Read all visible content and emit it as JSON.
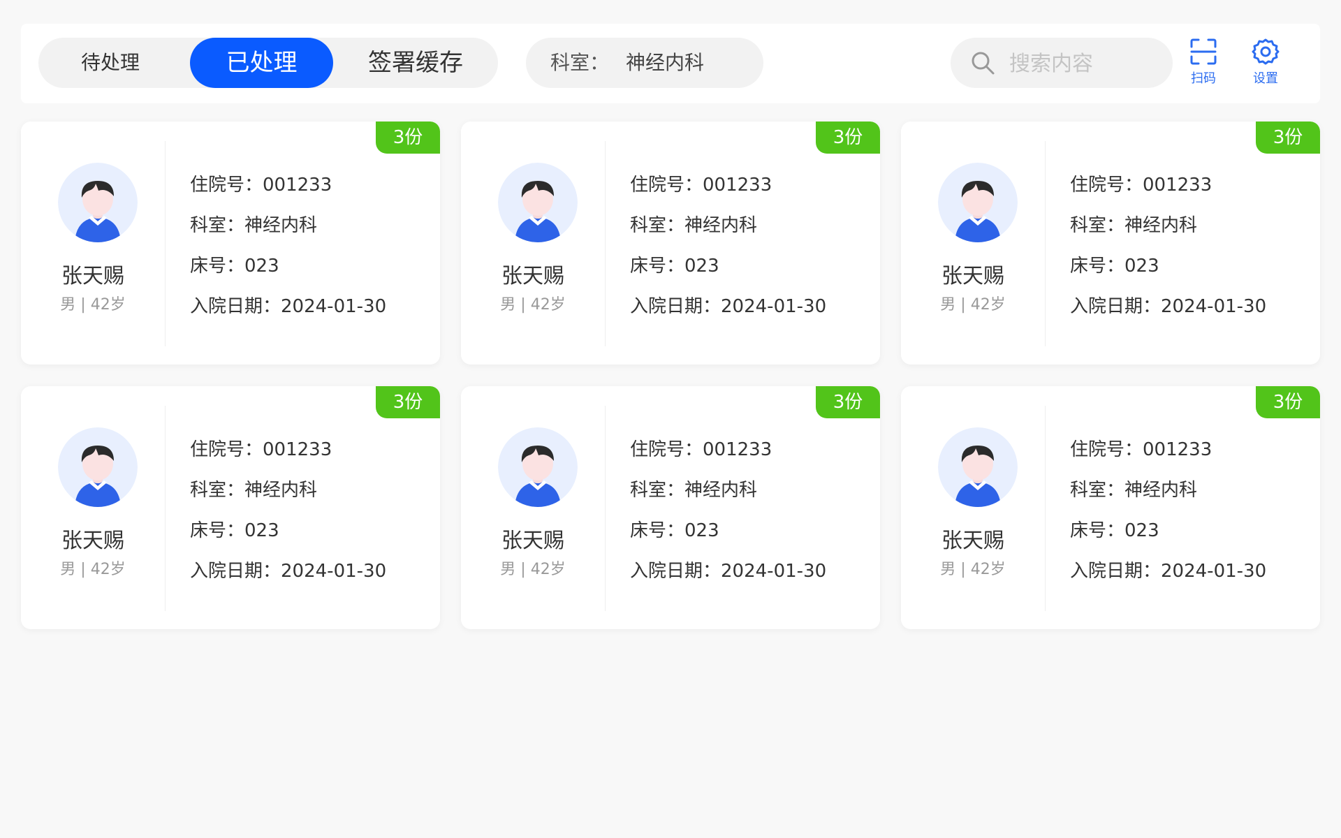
{
  "tabs": [
    {
      "label": "待处理"
    },
    {
      "label": "已处理"
    },
    {
      "label": "签署缓存"
    }
  ],
  "filter": {
    "label": "科室：",
    "value": "神经内科"
  },
  "search": {
    "placeholder": "搜索内容"
  },
  "tools": {
    "scan_label": "扫码",
    "settings_label": "设置"
  },
  "colors": {
    "accent": "#0a5bff",
    "badge": "#52c41a",
    "icon": "#2b6cf0",
    "avatar_bg": "#e8effe"
  },
  "patients": [
    {
      "badge": "3份",
      "name": "张天赐",
      "meta": "男 | 42岁",
      "admission_label": "住院号：",
      "admission_no": "001233",
      "dept_label": "科室：",
      "dept": "神经内科",
      "bed_label": "床号：",
      "bed": "023",
      "date_label": "入院日期：",
      "date": "2024-01-30"
    },
    {
      "badge": "3份",
      "name": "张天赐",
      "meta": "男 | 42岁",
      "admission_label": "住院号：",
      "admission_no": "001233",
      "dept_label": "科室：",
      "dept": "神经内科",
      "bed_label": "床号：",
      "bed": "023",
      "date_label": "入院日期：",
      "date": "2024-01-30"
    },
    {
      "badge": "3份",
      "name": "张天赐",
      "meta": "男 | 42岁",
      "admission_label": "住院号：",
      "admission_no": "001233",
      "dept_label": "科室：",
      "dept": "神经内科",
      "bed_label": "床号：",
      "bed": "023",
      "date_label": "入院日期：",
      "date": "2024-01-30"
    },
    {
      "badge": "3份",
      "name": "张天赐",
      "meta": "男 | 42岁",
      "admission_label": "住院号：",
      "admission_no": "001233",
      "dept_label": "科室：",
      "dept": "神经内科",
      "bed_label": "床号：",
      "bed": "023",
      "date_label": "入院日期：",
      "date": "2024-01-30"
    },
    {
      "badge": "3份",
      "name": "张天赐",
      "meta": "男 | 42岁",
      "admission_label": "住院号：",
      "admission_no": "001233",
      "dept_label": "科室：",
      "dept": "神经内科",
      "bed_label": "床号：",
      "bed": "023",
      "date_label": "入院日期：",
      "date": "2024-01-30"
    },
    {
      "badge": "3份",
      "name": "张天赐",
      "meta": "男 | 42岁",
      "admission_label": "住院号：",
      "admission_no": "001233",
      "dept_label": "科室：",
      "dept": "神经内科",
      "bed_label": "床号：",
      "bed": "023",
      "date_label": "入院日期：",
      "date": "2024-01-30"
    }
  ]
}
